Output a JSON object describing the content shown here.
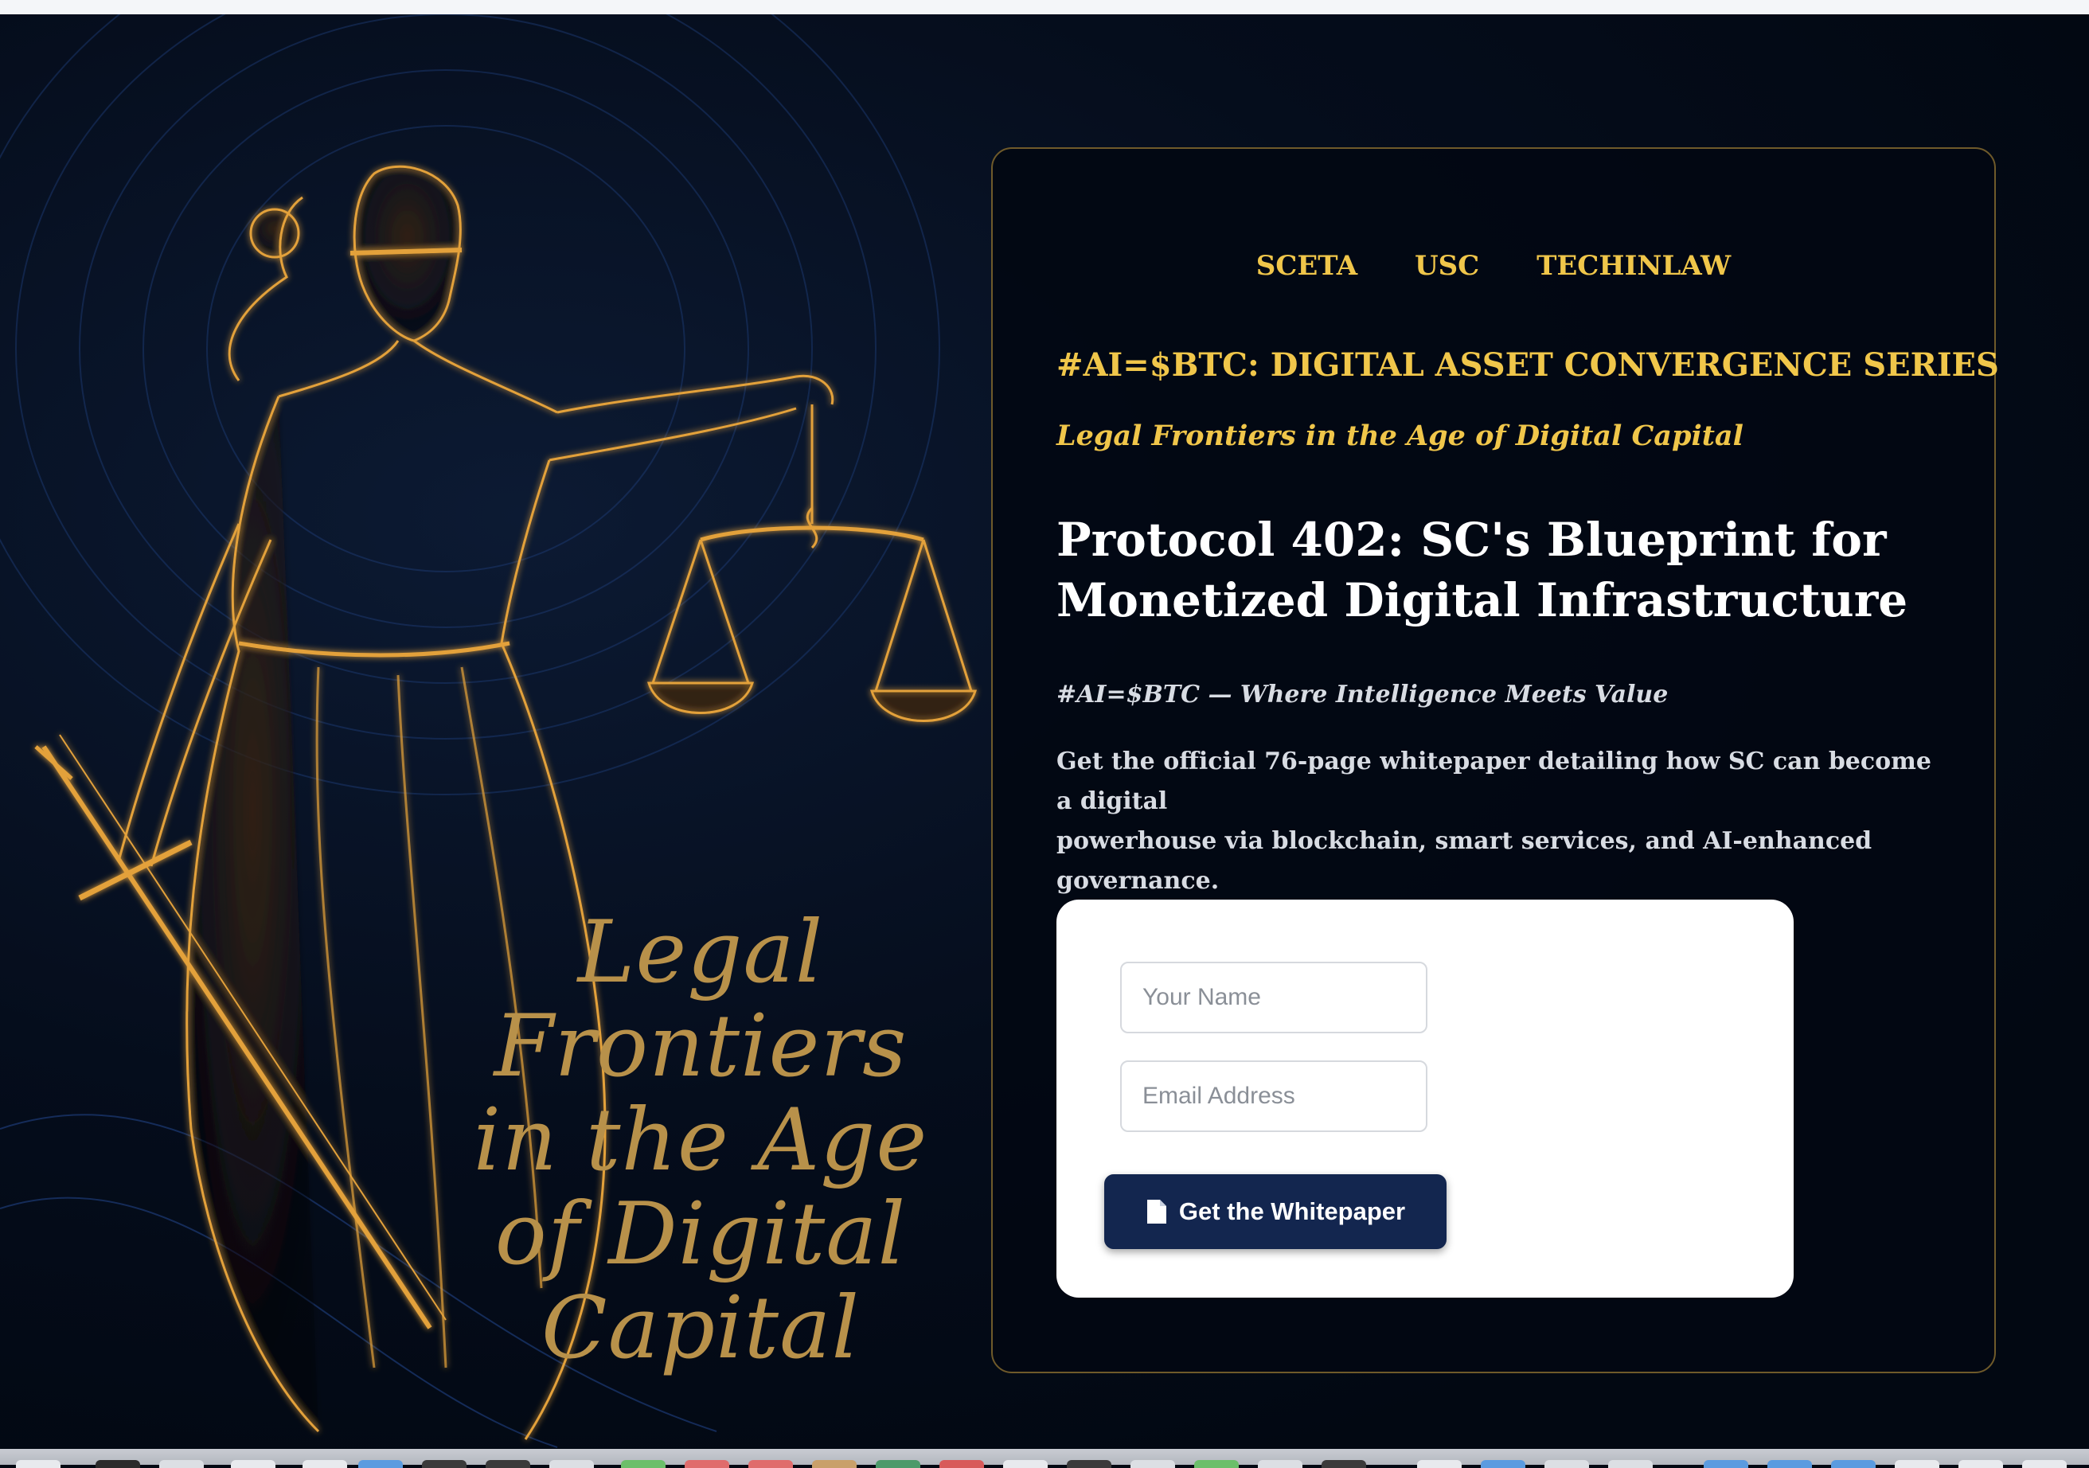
{
  "art": {
    "title_lines": [
      "Legal",
      "Frontiers",
      "in the Age",
      "of Digital",
      "Capital"
    ]
  },
  "card": {
    "logos": [
      "SCETA",
      "USC",
      "TECHINLAW"
    ],
    "series": "#AI=$BTC: DIGITAL ASSET CONVERGENCE SERIES",
    "subseries": "Legal Frontiers in the Age of Digital Capital",
    "headline_line1": "Protocol 402: SC's Blueprint for",
    "headline_line2": "Monetized Digital Infrastructure",
    "tagline": "#AI=$BTC — Where Intelligence Meets Value",
    "description_line1": "Get the official 76-page whitepaper detailing how SC can become a digital",
    "description_line2": "powerhouse via blockchain, smart services, and AI-enhanced governance."
  },
  "form": {
    "name_placeholder": "Your Name",
    "email_placeholder": "Email Address",
    "submit_label": "Get the Whitepaper",
    "submit_icon": "document-icon"
  },
  "colors": {
    "gold": "#f0c64a",
    "art_gold": "#b8914a",
    "navy_button": "#13264f",
    "background": "#020812"
  }
}
